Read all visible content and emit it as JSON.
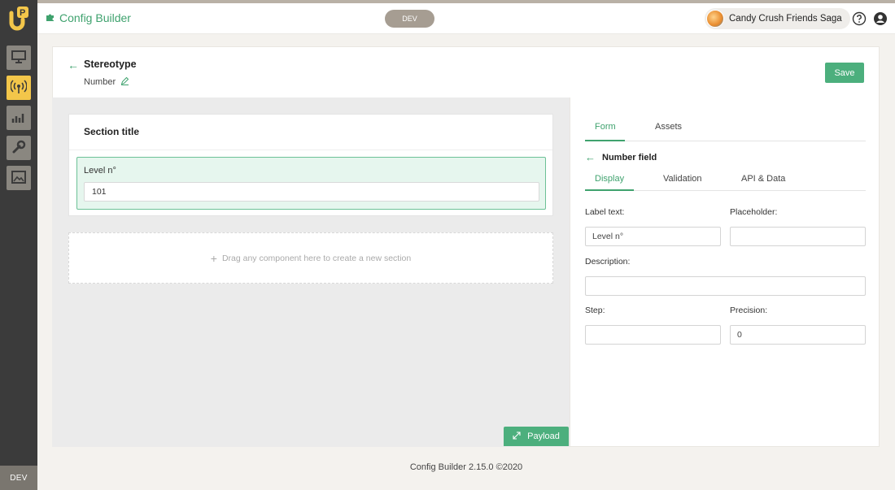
{
  "app": {
    "title": "Config Builder",
    "env": "DEV"
  },
  "header": {
    "env_pill": "DEV",
    "game_name": "Candy Crush Friends Saga",
    "icons": [
      "help-icon",
      "account-icon"
    ]
  },
  "rail": {
    "items": [
      "presentation-icon",
      "broadcast-icon",
      "analytics-icon",
      "wrench-icon",
      "image-icon"
    ],
    "active_index": 1,
    "env_label": "DEV"
  },
  "page": {
    "title": "Stereotype",
    "subtitle": "Number",
    "save_label": "Save"
  },
  "canvas": {
    "section_title": "Section title",
    "field_label": "Level n°",
    "field_value": "101",
    "dropzone_text": "Drag any component here to create a new section",
    "payload_label": "Payload"
  },
  "panel": {
    "tabs": [
      {
        "label": "Form",
        "active": true
      },
      {
        "label": "Assets",
        "active": false
      }
    ],
    "back_label": "Number field",
    "subtabs": [
      {
        "label": "Display",
        "active": true
      },
      {
        "label": "Validation",
        "active": false
      },
      {
        "label": "API & Data",
        "active": false
      }
    ],
    "fields": {
      "label_text": {
        "label": "Label text",
        "value": "Level n°"
      },
      "placeholder": {
        "label": "Placeholder",
        "value": ""
      },
      "description": {
        "label": "Description",
        "value": ""
      },
      "step": {
        "label": "Step",
        "value": ""
      },
      "precision": {
        "label": "Precision",
        "value": "0"
      }
    }
  },
  "footer": {
    "text": "Config Builder 2.15.0 ©2020"
  },
  "colors": {
    "accent": "#3fa26e",
    "button": "#4caf7d",
    "rail": "#3b3b3b",
    "rail_active": "#f3c64a"
  }
}
